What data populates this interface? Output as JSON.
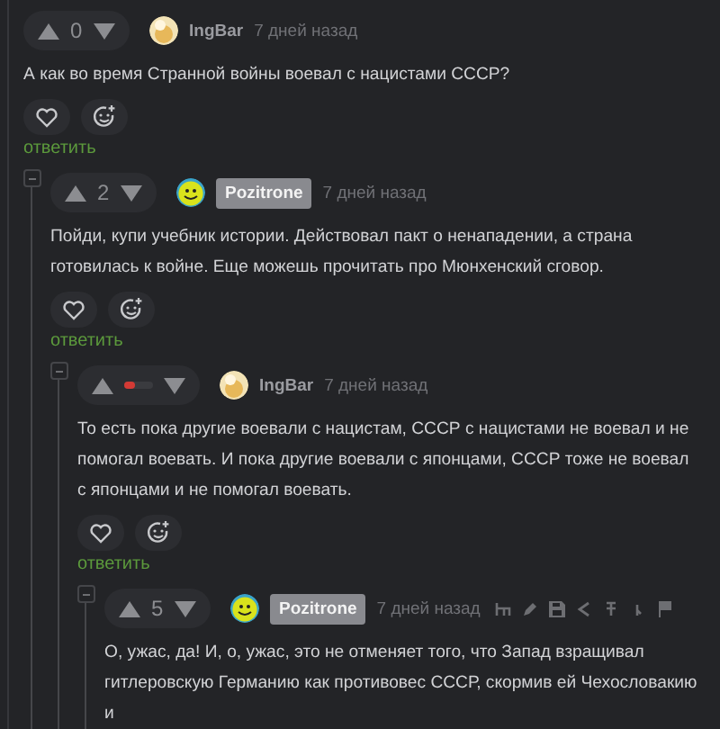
{
  "comments": [
    {
      "rating": {
        "kind": "score",
        "value": "0"
      },
      "author": "IngBar",
      "author_highlighted": false,
      "time": "7 дней назад",
      "actions_shown": false,
      "text": [
        "А как во время Странной войны воевал с нацистами СССР?"
      ],
      "reply": "ответить",
      "children": [
        {
          "rating": {
            "kind": "score",
            "value": "2"
          },
          "author": "Pozitrone",
          "author_highlighted": true,
          "time": "7 дней назад",
          "actions_shown": false,
          "text": [
            "Пойди, купи учебник истории. Действовал пакт о ненападении, а страна готовилась к войне. Еще можешь прочитать про Мюнхенский сговор."
          ],
          "reply": "ответить",
          "children": [
            {
              "rating": {
                "kind": "pending"
              },
              "author": "IngBar",
              "author_highlighted": false,
              "time": "7 дней назад",
              "actions_shown": false,
              "text": [
                "То есть пока другие воевали с нацистам, СССР с нацистами не воевал и не помогал воевать. И пока другие воевали с японцами, СССР тоже не воевал с японцами и не помогал воевать."
              ],
              "reply": "ответить",
              "children": [
                {
                  "rating": {
                    "kind": "score",
                    "value": "5"
                  },
                  "author": "Pozitrone",
                  "author_highlighted": true,
                  "time": "7 дней назад",
                  "actions_shown": true,
                  "text": [
                    "О, ужас, да! И, о, ужас, это не отменяет того, что Запад взращивал гитлеровскую Германию как противовес СССР, скормив ей Чехословакию и"
                  ]
                }
              ]
            }
          ]
        }
      ]
    }
  ]
}
